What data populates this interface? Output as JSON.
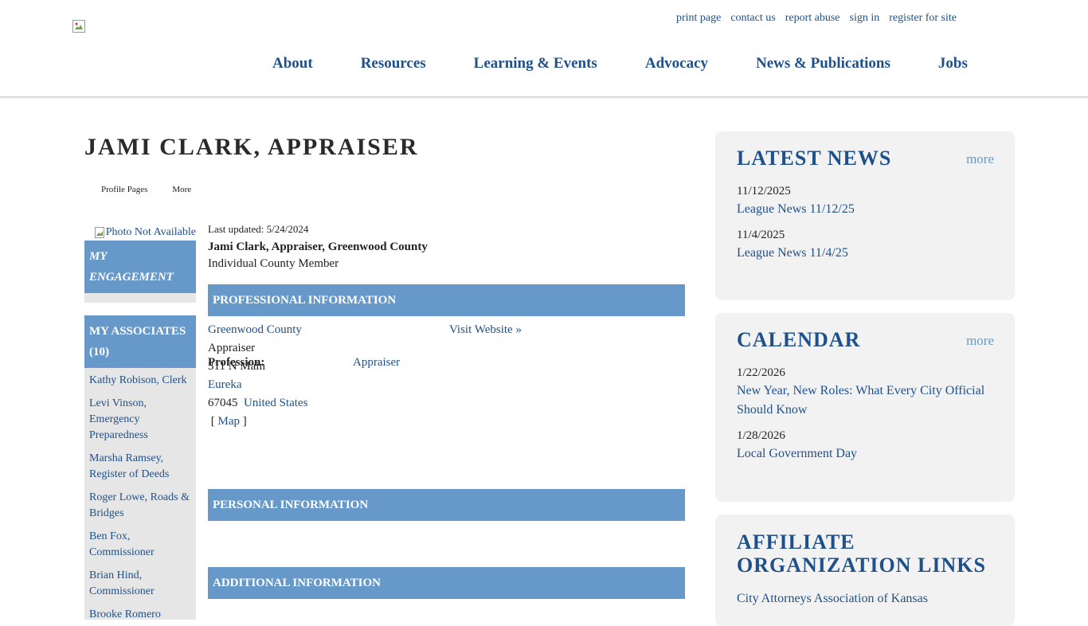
{
  "header": {
    "logo_alt": "",
    "util_links": [
      "print page",
      "contact us",
      "report abuse",
      "sign in",
      "register for site"
    ],
    "nav": [
      "About",
      "Resources",
      "Learning & Events",
      "Advocacy",
      "News & Publications",
      "Jobs"
    ]
  },
  "page": {
    "title": "JAMI CLARK, APPRAISER",
    "tabs": [
      "Profile Pages",
      "More"
    ]
  },
  "sidebar": {
    "photo_alt": "Photo Not Available",
    "engagement_title": "MY ENGAGEMENT",
    "associates_title": "MY ASSOCIATES (10)",
    "associates": [
      "Kathy Robison, Clerk",
      "Levi Vinson, Emergency Preparedness",
      "Marsha Ramsey, Register of Deeds",
      "Roger Lowe, Roads & Bridges",
      "Ben Fox, Commissioner",
      "Brian Hind, Commissioner",
      "Brooke Romero"
    ]
  },
  "profile": {
    "last_updated": "Last updated: 5/24/2024",
    "full_name": "Jami Clark, Appraiser, Greenwood County",
    "member_type": "Individual County Member",
    "sections": {
      "professional": "PROFESSIONAL INFORMATION",
      "personal": "PERSONAL INFORMATION",
      "additional": "ADDITIONAL INFORMATION"
    },
    "organization": "Greenwood County",
    "position": "Appraiser",
    "street": "311 N Main",
    "city": "Eureka",
    "zip": "67045",
    "country": "United States",
    "map_open": "[",
    "map_link": "Map",
    "map_close": "]",
    "website": "Visit Website »",
    "profession_label": "Profession:",
    "profession_value": "Appraiser"
  },
  "right": {
    "news": {
      "title": "LATEST NEWS",
      "more": "more",
      "items": [
        {
          "date": "11/12/2025",
          "title": "League News 11/12/25"
        },
        {
          "date": "11/4/2025",
          "title": "League News 11/4/25"
        }
      ]
    },
    "calendar": {
      "title": "CALENDAR",
      "more": "more",
      "items": [
        {
          "date": "1/22/2026",
          "title": "New Year, New Roles: What Every City Official Should Know"
        },
        {
          "date": "1/28/2026",
          "title": "Local Government Day"
        }
      ]
    },
    "affiliates": {
      "title": "AFFILIATE ORGANIZATION LINKS",
      "items": [
        "City Attorneys Association of Kansas"
      ]
    }
  },
  "colors": {
    "link": "#1f5089",
    "section_bar": "#6699c9",
    "sidebar_bg": "#e6e6e6",
    "box_bg": "#f2f2f2"
  }
}
